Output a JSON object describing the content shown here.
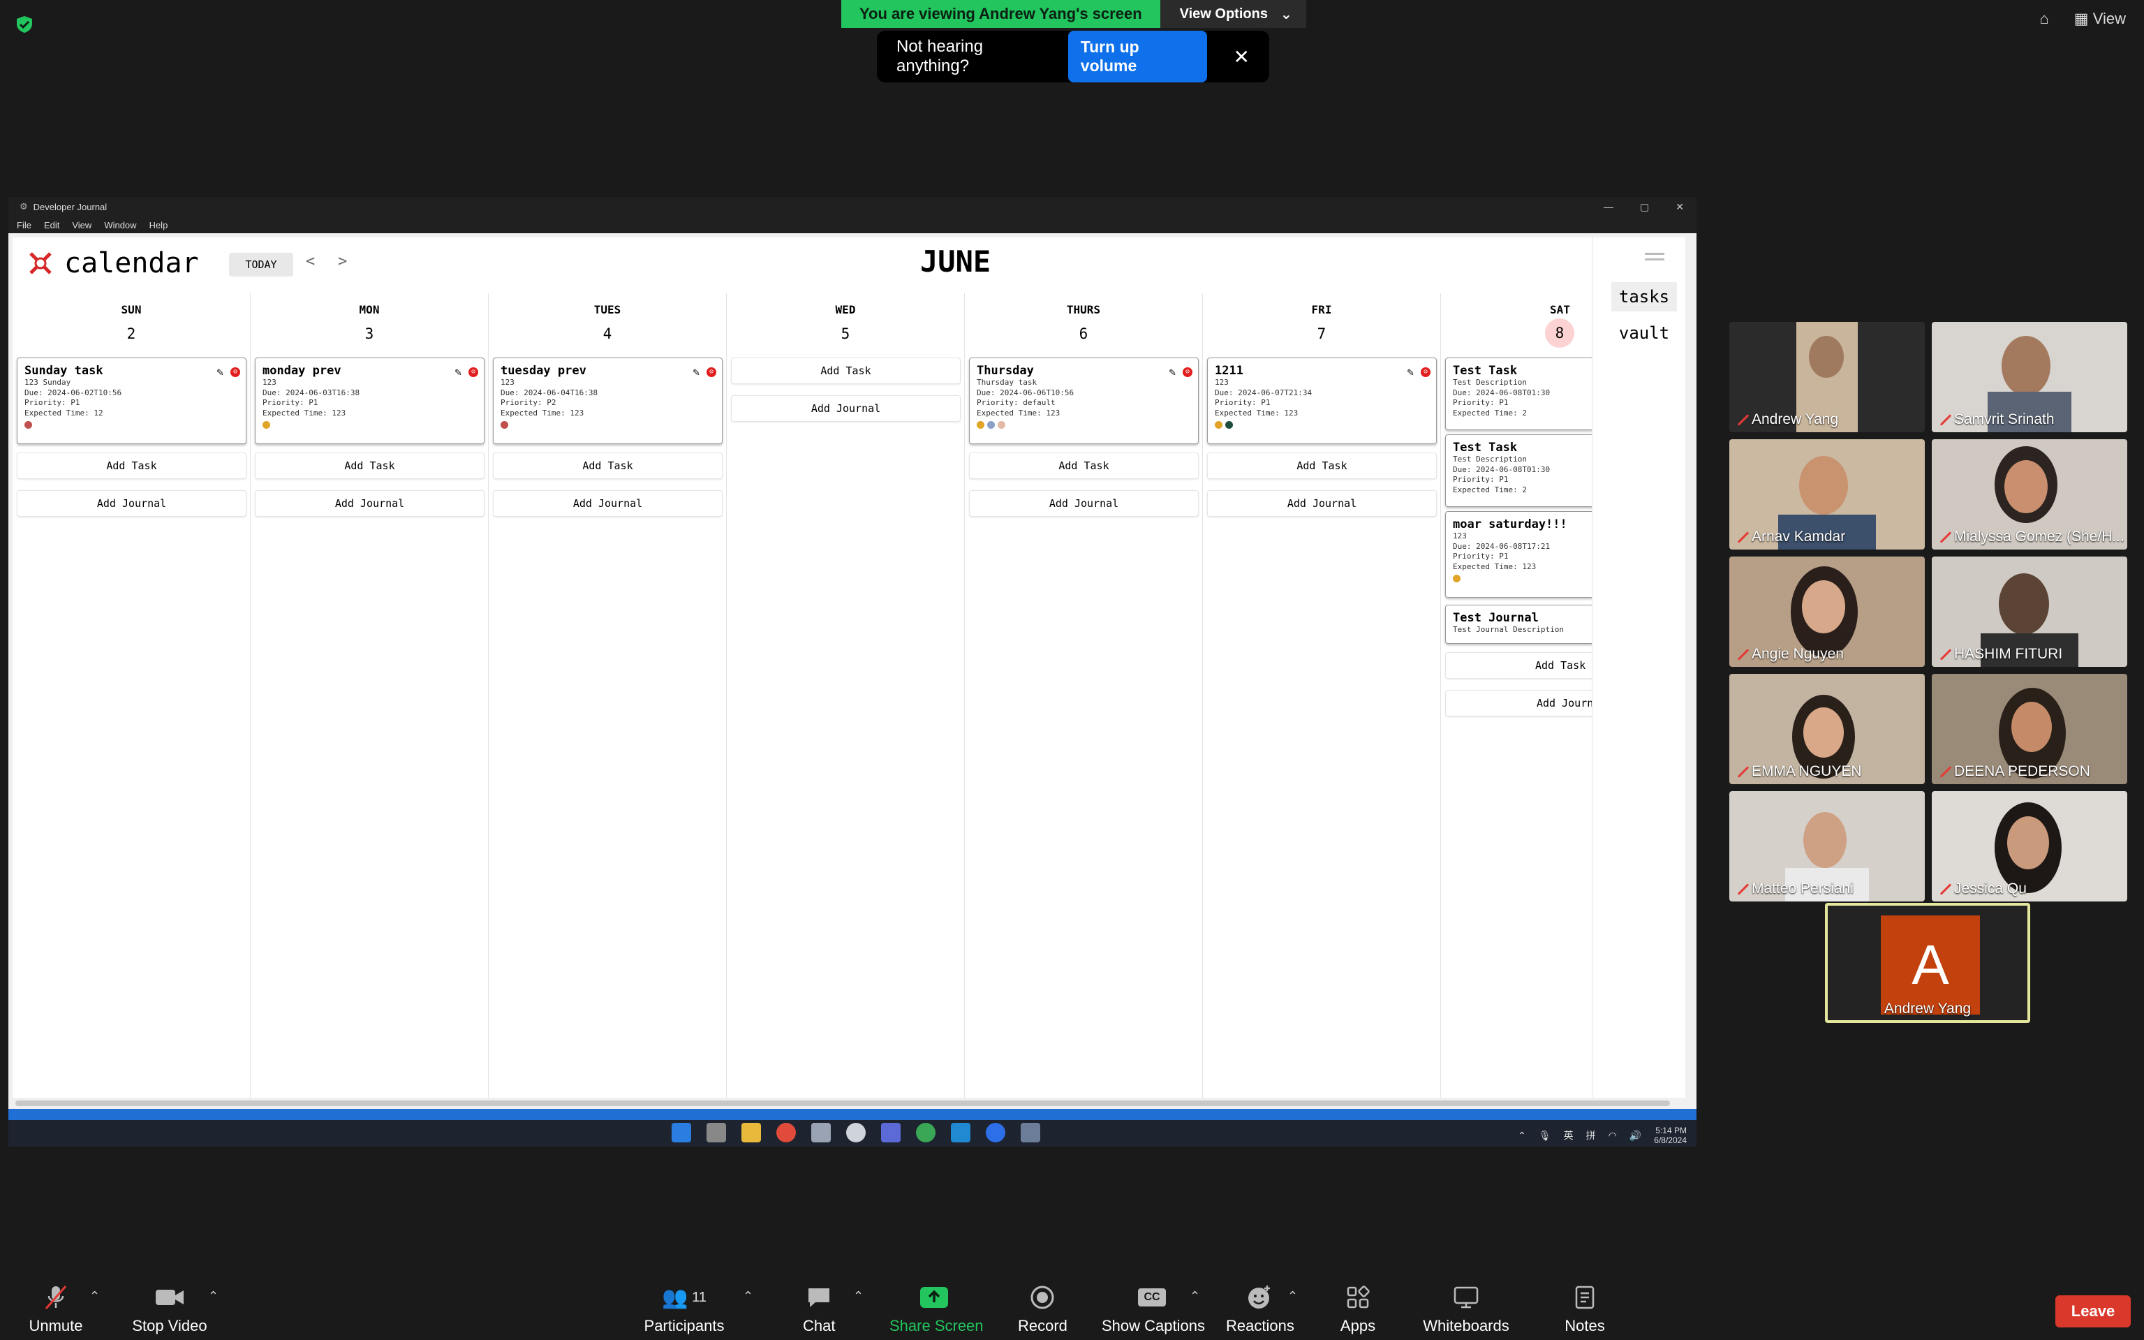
{
  "zoom": {
    "banner_text": "You are viewing Andrew Yang's screen",
    "view_options": "View Options",
    "toast_text": "Not hearing anything?",
    "toast_button": "Turn up volume",
    "view_label": "View"
  },
  "window": {
    "title": "Developer Journal",
    "menu": [
      "File",
      "Edit",
      "View",
      "Window",
      "Help"
    ]
  },
  "app": {
    "title": "calendar",
    "today": "TODAY",
    "prev": "<",
    "next": ">",
    "month": "JUNE",
    "side_tasks": "tasks",
    "side_vault": "vault",
    "add_task": "Add Task",
    "add_journal": "Add Journal",
    "add_task_cut": "Add Task",
    "add_journal_cut": "Add Journ"
  },
  "days": [
    {
      "dow": "SUN",
      "num": "2"
    },
    {
      "dow": "MON",
      "num": "3"
    },
    {
      "dow": "TUES",
      "num": "4"
    },
    {
      "dow": "WED",
      "num": "5"
    },
    {
      "dow": "THURS",
      "num": "6"
    },
    {
      "dow": "FRI",
      "num": "7"
    },
    {
      "dow": "SAT",
      "num": "8"
    }
  ],
  "cards": {
    "sun": {
      "title": "Sunday task",
      "l1": "123 Sunday",
      "l2": "Due: 2024-06-02T10:56",
      "l3": "Priority: P1",
      "l4": "Expected Time: 12"
    },
    "mon": {
      "title": "monday prev",
      "l1": "123",
      "l2": "Due: 2024-06-03T16:38",
      "l3": "Priority: P1",
      "l4": "Expected Time: 123"
    },
    "tue": {
      "title": "tuesday prev",
      "l1": "123",
      "l2": "Due: 2024-06-04T16:38",
      "l3": "Priority: P2",
      "l4": "Expected Time: 123"
    },
    "thu": {
      "title": "Thursday",
      "l1": "Thursday task",
      "l2": "Due: 2024-06-06T10:56",
      "l3": "Priority: default",
      "l4": "Expected Time: 123"
    },
    "fri": {
      "title": "1211",
      "l1": "123",
      "l2": "Due: 2024-06-07T21:34",
      "l3": "Priority: P1",
      "l4": "Expected Time: 123"
    },
    "sat1": {
      "title": "Test Task",
      "l1": "Test Description",
      "l2": "Due: 2024-06-08T01:30",
      "l3": "Priority: P1",
      "l4": "Expected Time: 2"
    },
    "sat2": {
      "title": "Test Task",
      "l1": "Test Description",
      "l2": "Due: 2024-06-08T01:30",
      "l3": "Priority: P1",
      "l4": "Expected Time: 2"
    },
    "sat3": {
      "title": "moar saturday!!!",
      "l1": "123",
      "l2": "Due: 2024-06-08T17:21",
      "l3": "Priority: P1",
      "l4": "Expected Time: 123"
    },
    "sat4": {
      "title": "Test Journal",
      "l1": "Test Journal Description"
    }
  },
  "taskbar": {
    "time": "5:14 PM",
    "date": "6/8/2024",
    "lang1": "英",
    "lang2": "拼"
  },
  "participants": [
    "Andrew Yang",
    "Samvrit Srinath",
    "Arnav Kamdar",
    "Mialyssa Gomez (She/H...",
    "Angie Nguyen",
    "HASHIM FITURI",
    "EMMA NGUYEN",
    "DEENA PEDERSON",
    "Matteo Persiani",
    "Jessica Qu"
  ],
  "self_tile": {
    "initial": "A",
    "name": "Andrew Yang"
  },
  "toolbar": {
    "unmute": "Unmute",
    "stop_video": "Stop Video",
    "participants": "Participants",
    "participants_count": "11",
    "chat": "Chat",
    "share": "Share Screen",
    "record": "Record",
    "captions": "Show Captions",
    "cc": "CC",
    "reactions": "Reactions",
    "apps": "Apps",
    "whiteboards": "Whiteboards",
    "notes": "Notes",
    "leave": "Leave"
  }
}
